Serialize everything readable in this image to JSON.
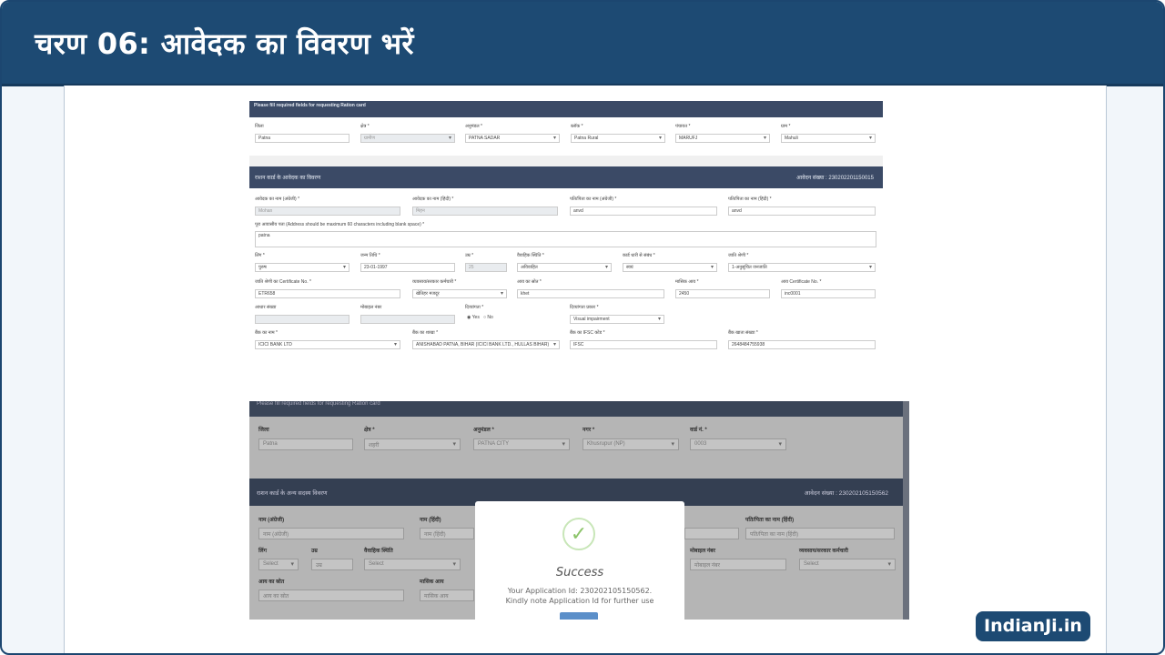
{
  "page_title": "चरण 06: आवेदक का विवरण भरें",
  "brand": "IndianJi.in",
  "form1": {
    "notice": "Please fill required fields for requesting Ration card",
    "row1": [
      {
        "label": "जिला",
        "value": "Patna"
      },
      {
        "label": "क्षेत्र *",
        "value": "ग्रामीण"
      },
      {
        "label": "अनुमंडल *",
        "value": "PATNA SADAR"
      },
      {
        "label": "ब्लॉक *",
        "value": "Patna Rural"
      },
      {
        "label": "पंचायत *",
        "value": "MARUFJ"
      },
      {
        "label": "ग्राम *",
        "value": "Mahuli"
      }
    ],
    "section_title": "राशन कार्ड के आवेदक का विवरण",
    "application_no": "आवेदन संख्या : 230202201150015",
    "name_eng": {
      "label": "आवेदक का नाम (अंग्रेजी) *",
      "value": "Mohan"
    },
    "name_hin": {
      "label": "आवेदक का नाम (हिंदी) *",
      "value": "मिहन"
    },
    "husband_eng": {
      "label": "पति/पिता का नाम (अंग्रेजी) *",
      "value": "anvd"
    },
    "husband_hin": {
      "label": "पति/पिता का नाम (हिंदी) *",
      "value": "anvd"
    },
    "address": {
      "label": "पूरा आवासीय पता (Address should be maximum 60 characters including blank space) *",
      "value": "patna"
    },
    "gender": {
      "label": "लिंग *",
      "value": "पुरुष"
    },
    "dob": {
      "label": "जन्म तिथि *",
      "value": "23-01-1997"
    },
    "age": {
      "label": "उम्र *",
      "value": "25"
    },
    "marital": {
      "label": "वैवाहिक स्थिति *",
      "value": "अविवाहित"
    },
    "relation": {
      "label": "कार्ड धारी से संबंध *",
      "value": "स्वयं"
    },
    "caste": {
      "label": "जाति श्रेणी *",
      "value": "1-अनुसूचित जनजाति"
    },
    "caste_cert": {
      "label": "जाति श्रेणी का Certificate No. *",
      "value": "ETR658"
    },
    "occupation": {
      "label": "व्यवसाय/सरकार कर्मचारी *",
      "value": "खेतिहर मजदूर"
    },
    "income_src": {
      "label": "आय का स्रोत *",
      "value": "khet"
    },
    "monthly_income": {
      "label": "मासिक आय *",
      "value": "2450"
    },
    "income_cert": {
      "label": "आय Certificate No. *",
      "value": "inc0001"
    },
    "aadhaar": {
      "label": "आधार संख्या",
      "value": ""
    },
    "mobile": {
      "label": "मोबाइल नंबर",
      "value": ""
    },
    "disabled": {
      "label": "दिव्यांगता *",
      "yes": "Yes",
      "no": "No"
    },
    "disability_type": {
      "label": "दिव्यांगता प्रकार *",
      "value": "Visual impairment"
    },
    "bank_name": {
      "label": "बैंक का नाम *",
      "value": "ICICI BANK LTD"
    },
    "bank_branch": {
      "label": "बैंक का शाखा *",
      "value": "ANISHABAD PATNA, BIHAR (ICICI BANK LTD., HULLAS BIHAR)"
    },
    "ifsc": {
      "label": "बैंक का IFSC कोड *",
      "value": "IFSC"
    },
    "account": {
      "label": "बैंक खाता संख्या *",
      "value": "2648484755938"
    }
  },
  "form2": {
    "notice": "Please fill required fields for requesting Ration card",
    "row1": [
      {
        "label": "जिला",
        "value": "Patna"
      },
      {
        "label": "क्षेत्र *",
        "value": "शहरी"
      },
      {
        "label": "अनुमंडल *",
        "value": "PATNA CITY"
      },
      {
        "label": "नगर *",
        "value": "Khusrupur (NP)"
      },
      {
        "label": "वार्ड नं. *",
        "value": "0003"
      }
    ],
    "section_title": "राशन कार्ड के अन्य सदस्य विवरण",
    "application_no": "आवेदन संख्या : 230202105150562",
    "name_eng": {
      "label": "नाम (अंग्रेजी)",
      "placeholder": "नाम (अंग्रेजी)"
    },
    "name_hin": {
      "label": "नाम (हिंदी)",
      "placeholder": "नाम (हिंदी)"
    },
    "husband_hin": {
      "label": "पति/पिता का नाम (हिंदी)",
      "placeholder": "पति/पिता का नाम (हिंदी)"
    },
    "gender": {
      "label": "लिंग",
      "value": "Select"
    },
    "age": {
      "label": "उम्र",
      "value": "उम्र"
    },
    "marital": {
      "label": "वैवाहिक स्थिति",
      "value": "Select"
    },
    "mobile": {
      "label": "मोबाइल नंबर",
      "placeholder": "मोबाइल नंबर"
    },
    "occupation": {
      "label": "व्यवसाय/सरकार कर्मचारी",
      "value": "Select"
    },
    "income_src": {
      "label": "आय का स्रोत",
      "placeholder": "आय का स्रोत"
    },
    "monthly_income": {
      "label": "मासिक आय",
      "placeholder": "मासिक आय"
    },
    "modal": {
      "title": "Success",
      "line1": "Your Application Id: 230202105150562.",
      "line2": "Kindly note Application Id for further use"
    }
  }
}
